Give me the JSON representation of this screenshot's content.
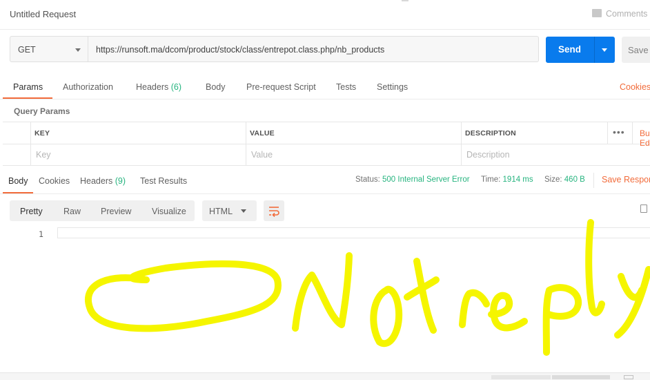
{
  "header": {
    "title": "Untitled Request",
    "comments_label": "Comments"
  },
  "request": {
    "method": "GET",
    "url": "https://runsoft.ma/dcom/product/stock/class/entrepot.class.php/nb_products",
    "send_label": "Send",
    "save_label": "Save"
  },
  "request_tabs": {
    "params": "Params",
    "authorization": "Authorization",
    "headers": "Headers",
    "headers_count": "(6)",
    "body": "Body",
    "pre_request": "Pre-request Script",
    "tests": "Tests",
    "settings": "Settings",
    "cookies": "Cookies"
  },
  "query_params": {
    "title": "Query Params",
    "columns": [
      "KEY",
      "VALUE",
      "DESCRIPTION"
    ],
    "placeholders": [
      "Key",
      "Value",
      "Description"
    ],
    "more": "•••",
    "bulk_edit": "Bulk Edit"
  },
  "response_tabs": {
    "body": "Body",
    "cookies": "Cookies",
    "headers": "Headers",
    "headers_count": "(9)",
    "test_results": "Test Results"
  },
  "response_meta": {
    "status_label": "Status:",
    "status_value": "500 Internal Server Error",
    "time_label": "Time:",
    "time_value": "1914 ms",
    "size_label": "Size:",
    "size_value": "460 B",
    "save_response": "Save Response"
  },
  "body_toolbar": {
    "views": [
      "Pretty",
      "Raw",
      "Preview",
      "Visualize"
    ],
    "format": "HTML"
  },
  "editor": {
    "line_number": "1"
  },
  "colors": {
    "accent": "#f26b3a",
    "send": "#097bed",
    "success": "#26b47f",
    "scribble": "#f5f500"
  },
  "icons": [
    "comment-icon",
    "chevron-down-icon",
    "wrap-lines-icon",
    "copy-icon"
  ]
}
